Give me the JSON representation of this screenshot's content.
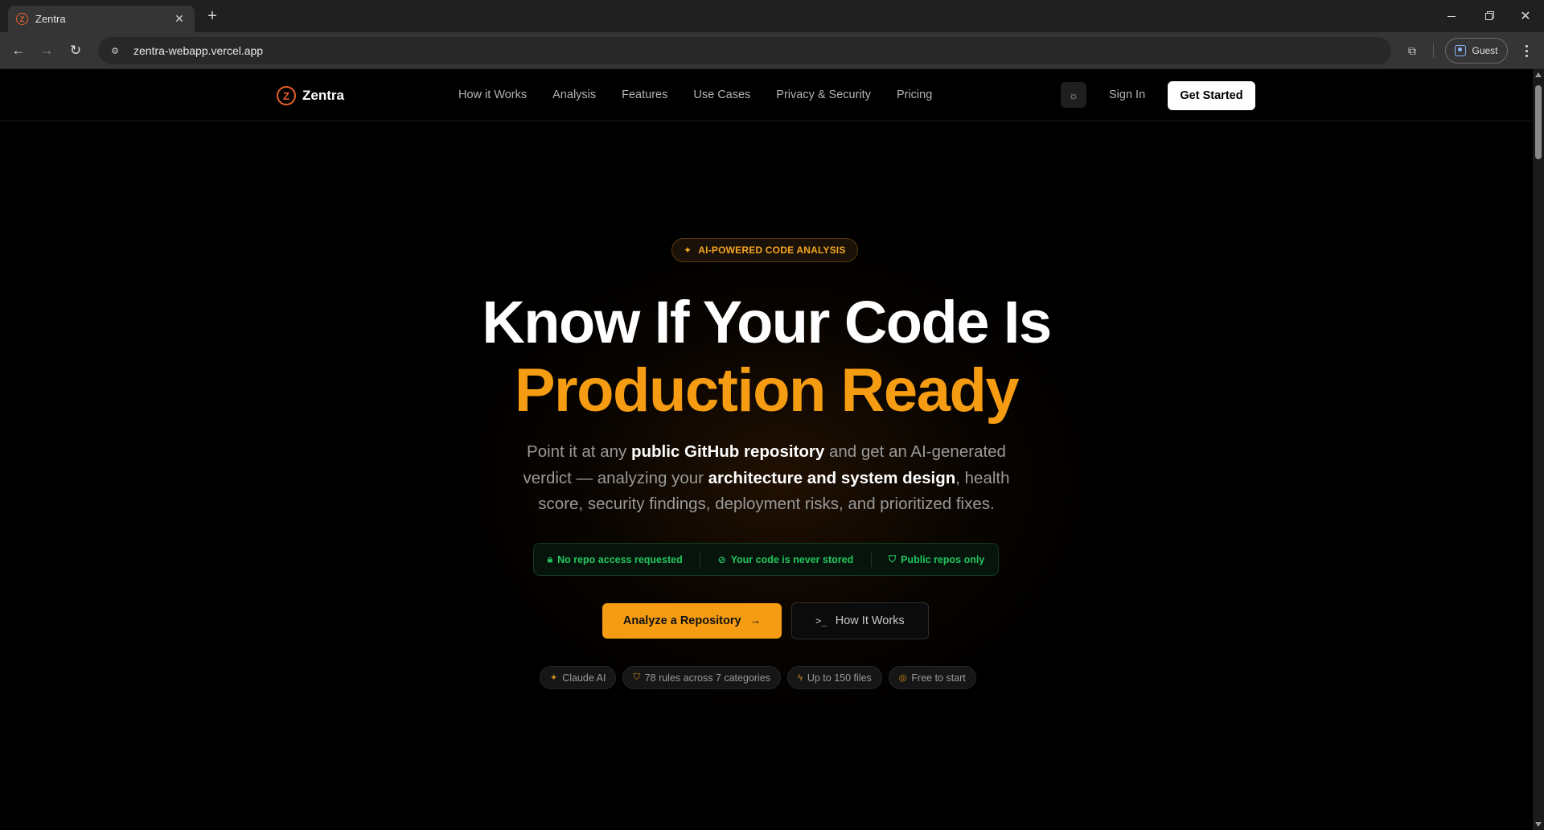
{
  "browser": {
    "tab_title": "Zentra",
    "favicon_letter": "Z",
    "url": "zentra-webapp.vercel.app",
    "profile_label": "Guest"
  },
  "site": {
    "logo_letter": "Z",
    "brand": "Zentra",
    "nav": [
      "How it Works",
      "Analysis",
      "Features",
      "Use Cases",
      "Privacy & Security",
      "Pricing"
    ],
    "sign_in": "Sign In",
    "get_started": "Get Started"
  },
  "hero": {
    "badge": "AI-POWERED CODE ANALYSIS",
    "title_line1": "Know If Your Code Is",
    "title_line2": "Production Ready",
    "subtitle": {
      "p1": "Point it at any ",
      "b1": "public GitHub repository",
      "p2": " and get an AI-generated verdict — analyzing your ",
      "b2": "architecture and system design",
      "p3": ", health score, security findings, deployment risks, and prioritized fixes."
    },
    "trust": [
      "No repo access requested",
      "Your code is never stored",
      "Public repos only"
    ],
    "cta_primary": "Analyze a Repository",
    "cta_secondary": "How It Works",
    "chips": [
      "Claude AI",
      "78 rules across 7 categories",
      "Up to 150 files",
      "Free to start"
    ]
  },
  "colors": {
    "accent": "#f59c12",
    "brand_mark": "#e8622c",
    "trust_green": "#22c55e",
    "background": "#000000"
  },
  "icons": {
    "badge": "sparkles-icon",
    "trust": [
      "lock-icon",
      "eye-off-icon",
      "shield-check-icon"
    ],
    "chips": [
      "sparkles-icon",
      "shield-icon",
      "zap-icon",
      "check-circle-icon"
    ]
  }
}
